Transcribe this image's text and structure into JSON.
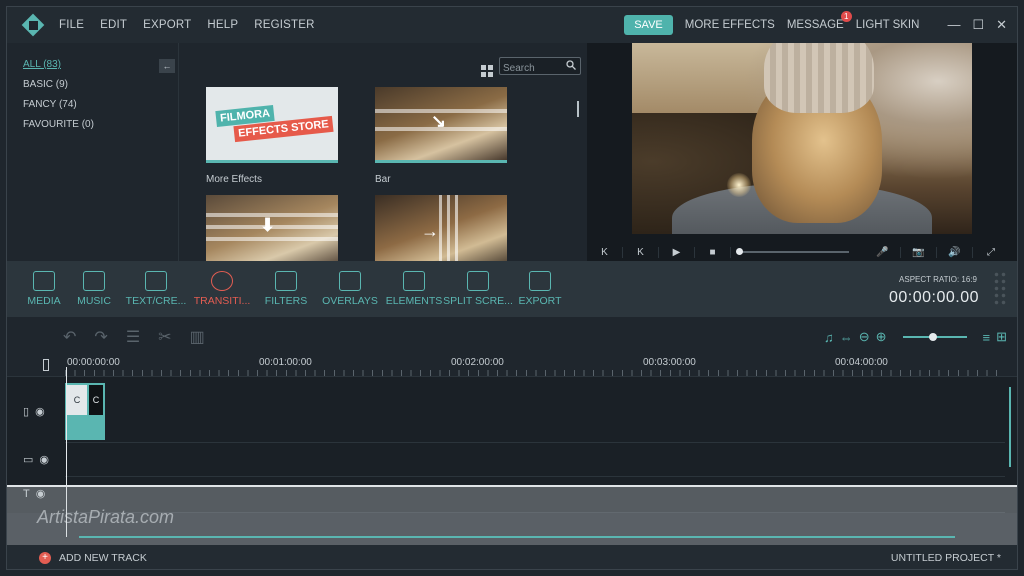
{
  "titlebar": {
    "menu": [
      "FILE",
      "EDIT",
      "EXPORT",
      "HELP",
      "REGISTER"
    ],
    "save_label": "SAVE",
    "more_effects": "MORE EFFECTS",
    "message": "MESSAGE",
    "message_count": "1",
    "light_skin": "LIGHT SKIN",
    "minimize": "—",
    "maximize": "☐",
    "close": "✕"
  },
  "categories": {
    "items": [
      "ALL (83)",
      "BASIC (9)",
      "FANCY (74)",
      "FAVOURITE (0)"
    ],
    "active_index": 0
  },
  "library": {
    "search_placeholder": "Search",
    "thumbs": [
      {
        "label": "More Effects",
        "line1": "FILMORA",
        "line2": "EFFECTS STORE"
      },
      {
        "label": "Bar"
      }
    ]
  },
  "player": {
    "controls": [
      "K",
      "K",
      "▶",
      "■"
    ],
    "mic": "🎤",
    "camera": "📷",
    "volume": "🔊",
    "fullscreen": "⤢"
  },
  "toolbar": {
    "tools": [
      "MEDIA",
      "MUSIC",
      "TEXT/CRE...",
      "TRANSITI...",
      "FILTERS",
      "OVERLAYS",
      "ELEMENTS",
      "SPLIT SCRE...",
      "EXPORT"
    ],
    "active_index": 3,
    "aspect_ratio": "ASPECT RATIO: 16:9",
    "timecode": "00:00:00.00"
  },
  "ruler": {
    "times": [
      "00:00:00:00",
      "00:01:00:00",
      "00:02:00:00",
      "00:03:00:00",
      "00:04:00:00"
    ]
  },
  "clip": {
    "frame1": "C",
    "frame2": "C"
  },
  "watermark": "ArtistaPirata.com",
  "status": {
    "add_track": "ADD NEW TRACK",
    "project": "UNTITLED PROJECT *"
  },
  "colors": {
    "accent": "#5ab6b1",
    "active": "#e35d52",
    "background": "#1f262d"
  }
}
